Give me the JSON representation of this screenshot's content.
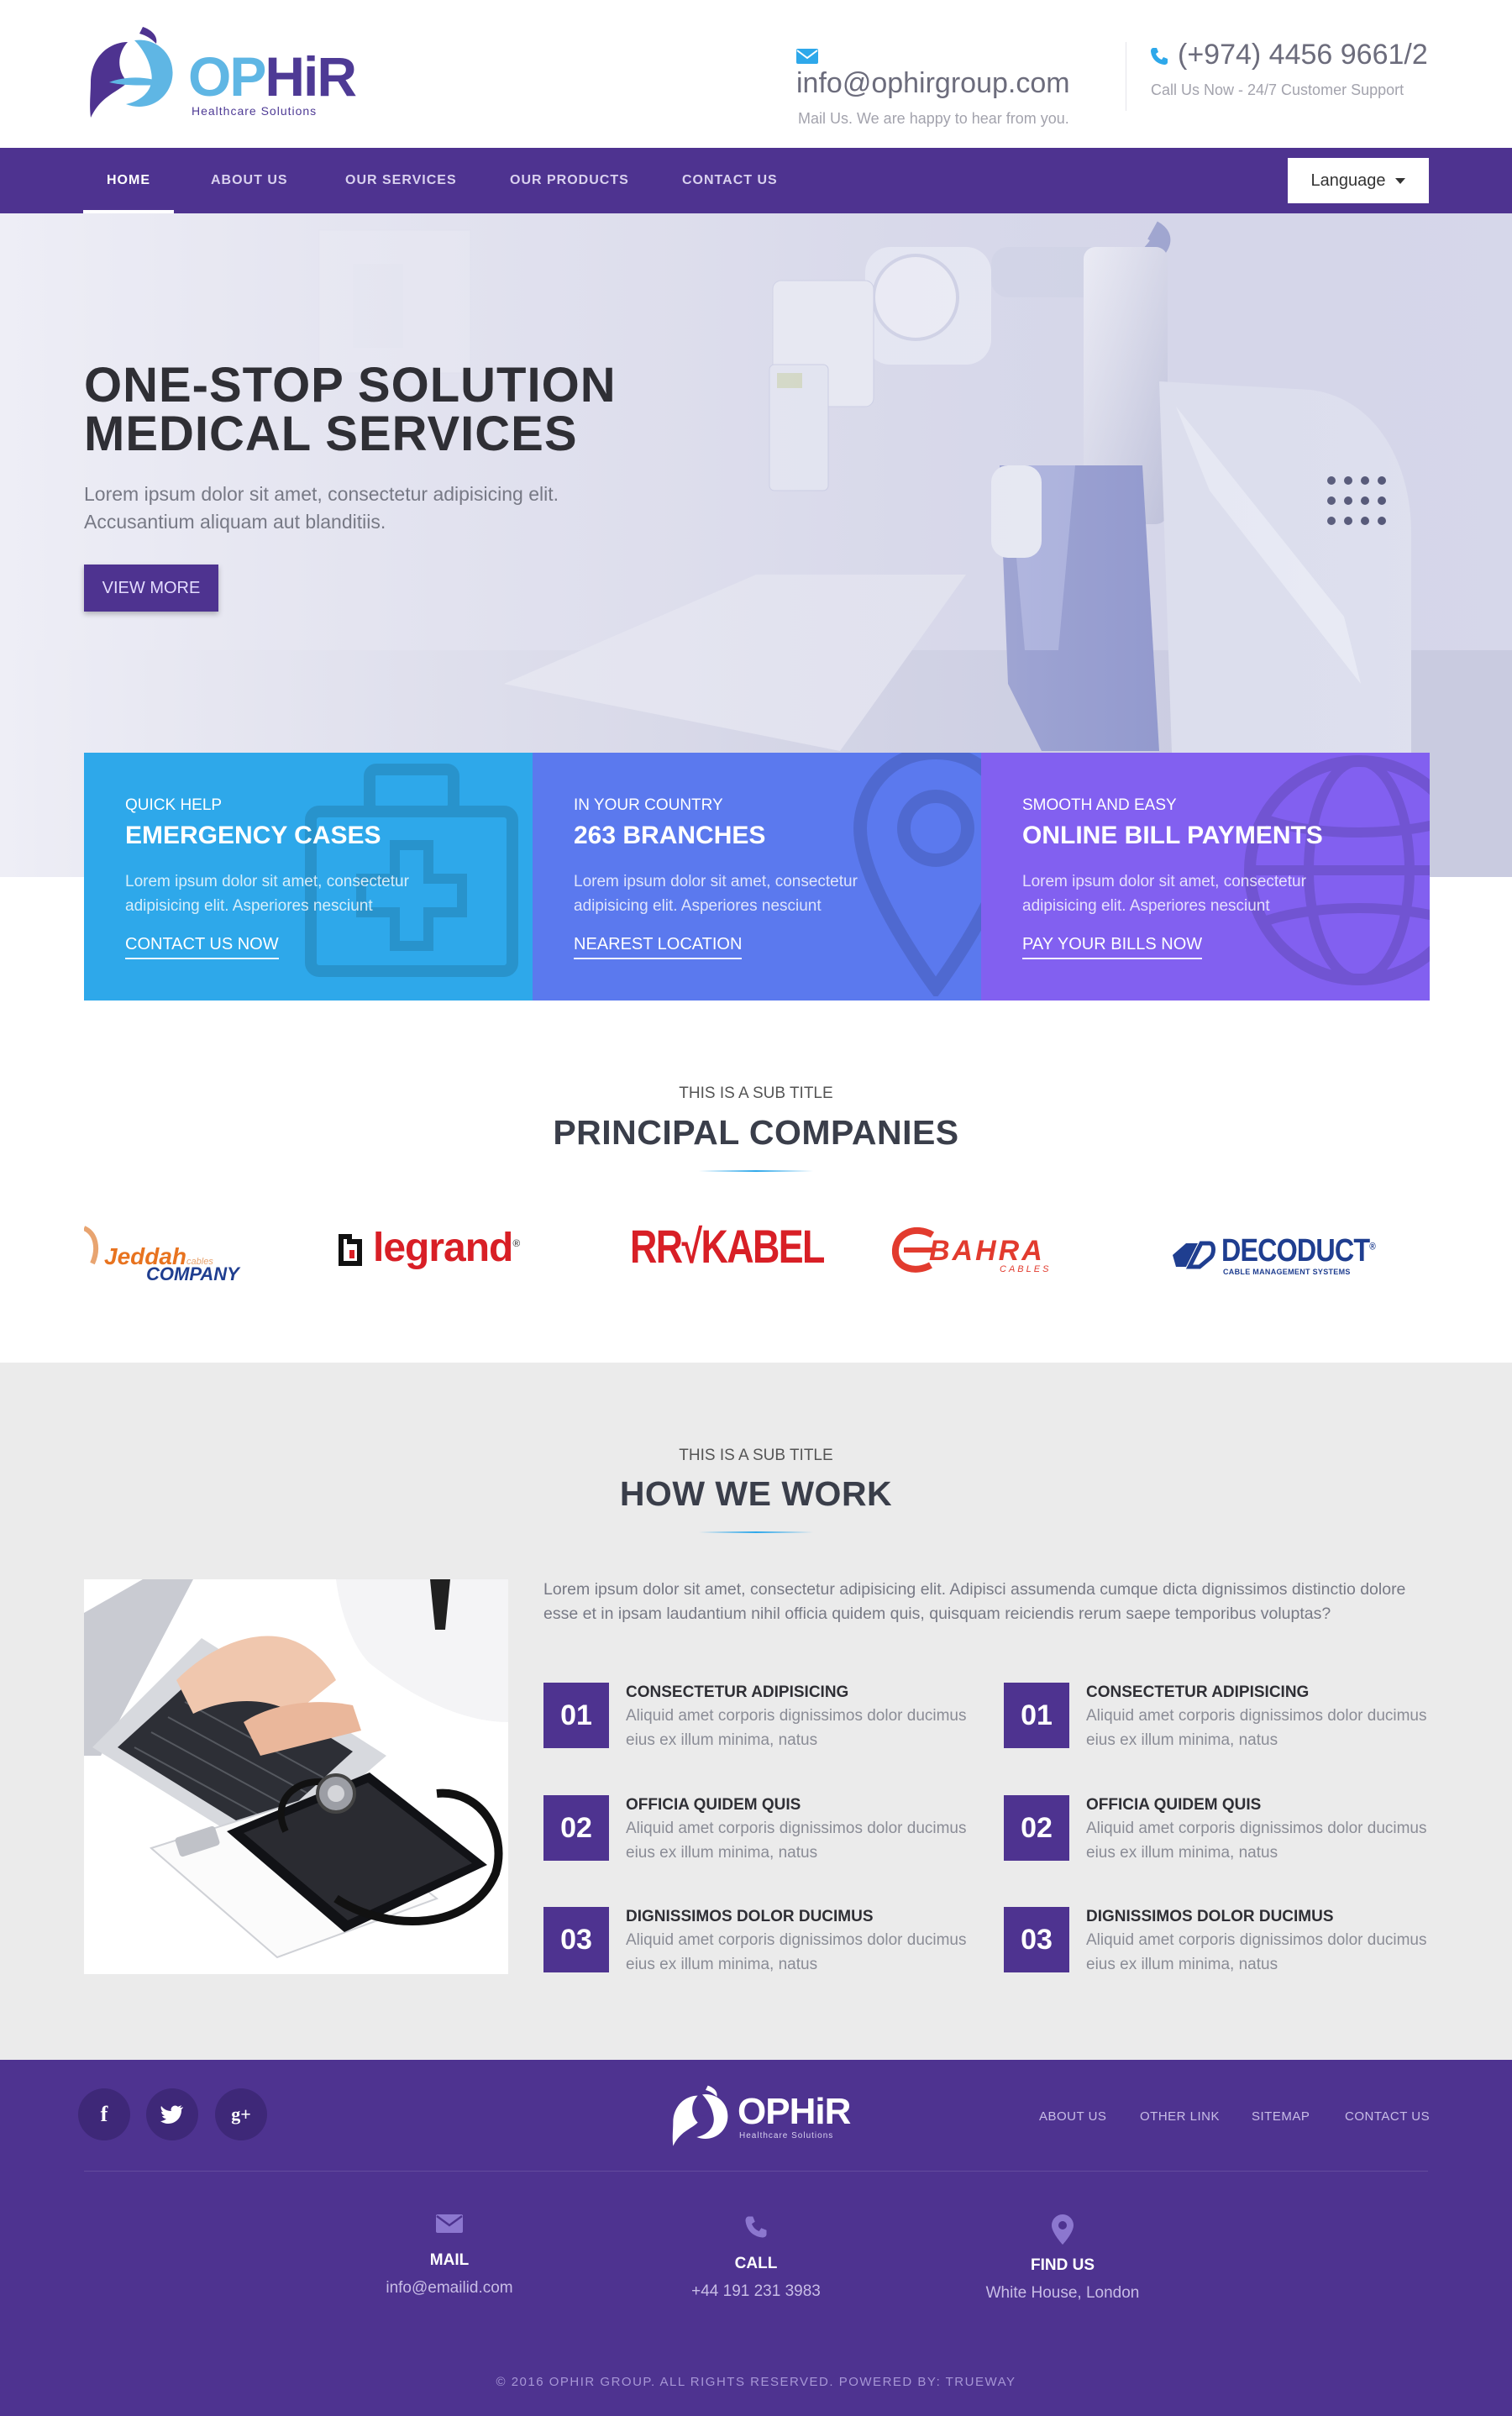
{
  "brand": {
    "name": "OPHiR",
    "name_first": "OP",
    "name_last": "HiR",
    "tagline": "Healthcare Solutions",
    "primary_color": "#4e3390",
    "accent_color": "#2ea8ea"
  },
  "header": {
    "email": "info@ophirgroup.com",
    "email_note": "Mail Us. We are happy to hear from you.",
    "phone": "(+974) 4456 9661/2",
    "phone_note": "Call Us Now - 24/7 Customer Support"
  },
  "nav": {
    "items": [
      "HOME",
      "ABOUT US",
      "OUR SERVICES",
      "OUR PRODUCTS",
      "CONTACT US"
    ],
    "active": "HOME",
    "language_label": "Language"
  },
  "hero": {
    "title_line1": "ONE-STOP SOLUTION",
    "title_line2": "MEDICAL SERVICES",
    "text_line1": "Lorem ipsum dolor sit amet, consectetur adipisicing elit.",
    "text_line2": "Accusantium aliquam aut blanditiis.",
    "button": "VIEW MORE"
  },
  "features": [
    {
      "kicker": "QUICK HELP",
      "title": "EMERGENCY CASES",
      "desc": "Lorem ipsum dolor sit amet, consectetur adipisicing elit. Asperiores nesciunt",
      "link": "CONTACT US NOW",
      "color": "#2ea8ea"
    },
    {
      "kicker": "IN YOUR COUNTRY",
      "title": "263 BRANCHES",
      "desc": "Lorem ipsum dolor sit amet, consectetur adipisicing elit. Asperiores nesciunt",
      "link": "NEAREST LOCATION",
      "color": "#5b79ee"
    },
    {
      "kicker": "SMOOTH AND EASY",
      "title": "ONLINE BILL PAYMENTS",
      "desc": "Lorem ipsum dolor sit amet, consectetur adipisicing elit. Asperiores nesciunt",
      "link": "PAY YOUR BILLS NOW",
      "color": "#8260f0"
    }
  ],
  "companies": {
    "subtitle": "THIS IS A SUB TITLE",
    "title": "PRINCIPAL COMPANIES",
    "logos": [
      {
        "name": "Jeddah",
        "small": "cables",
        "line2": "COMPANY"
      },
      {
        "name": "legrand",
        "mark": "®"
      },
      {
        "name": "RR",
        "name2": "KABEL"
      },
      {
        "name": "BAHRA",
        "small": "CABLES"
      },
      {
        "name": "DECODUCT",
        "mark": "®",
        "small": "CABLE MANAGEMENT SYSTEMS"
      }
    ]
  },
  "how": {
    "subtitle": "THIS IS A SUB TITLE",
    "title": "HOW WE WORK",
    "intro": "Lorem ipsum dolor sit amet, consectetur adipisicing elit. Adipisci assumenda cumque dicta dignissimos distinctio dolore esse et in ipsam laudantium nihil officia quidem quis, quisquam reiciendis rerum saepe temporibus voluptas?",
    "steps_left": [
      {
        "num": "01",
        "title": "CONSECTETUR ADIPISICING",
        "desc": "Aliquid amet corporis dignissimos dolor ducimus eius ex illum minima, natus"
      },
      {
        "num": "02",
        "title": "OFFICIA QUIDEM QUIS",
        "desc": "Aliquid amet corporis dignissimos dolor ducimus eius ex illum minima, natus"
      },
      {
        "num": "03",
        "title": "DIGNISSIMOS DOLOR DUCIMUS",
        "desc": "Aliquid amet corporis dignissimos dolor ducimus eius ex illum minima, natus"
      }
    ],
    "steps_right": [
      {
        "num": "01",
        "title": "CONSECTETUR ADIPISICING",
        "desc": "Aliquid amet corporis dignissimos dolor ducimus eius ex illum minima, natus"
      },
      {
        "num": "02",
        "title": "OFFICIA QUIDEM QUIS",
        "desc": "Aliquid amet corporis dignissimos dolor ducimus eius ex illum minima, natus"
      },
      {
        "num": "03",
        "title": "DIGNISSIMOS DOLOR DUCIMUS",
        "desc": "Aliquid amet corporis dignissimos dolor ducimus eius ex illum minima, natus"
      }
    ]
  },
  "footer": {
    "social": [
      "f",
      "twitter-icon",
      "g+"
    ],
    "social_glyph_google": "g+",
    "social_glyph_facebook": "f",
    "links": [
      "ABOUT US",
      "OTHER LINK",
      "SITEMAP",
      "CONTACT US"
    ],
    "contacts": [
      {
        "label": "MAIL",
        "value": "info@emailid.com",
        "icon": "mail-icon"
      },
      {
        "label": "CALL",
        "value": "+44 191 231 3983",
        "icon": "phone-icon"
      },
      {
        "label": "FIND US",
        "value": "White House, London",
        "icon": "map-pin-icon"
      }
    ],
    "copyright": "© 2016 OPHIR GROUP. ALL RIGHTS RESERVED. POWERED BY: TRUEWAY"
  }
}
